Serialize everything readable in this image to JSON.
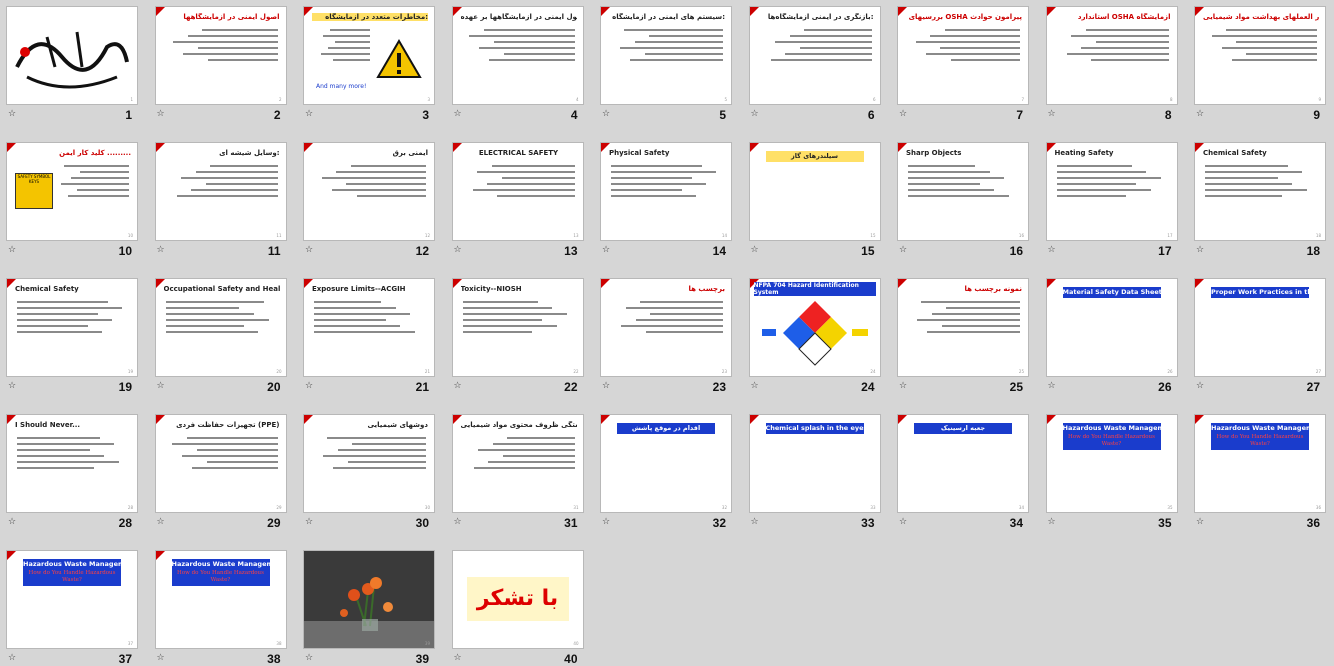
{
  "slides": [
    {
      "num": "1",
      "title": "",
      "kind": "calligraphy"
    },
    {
      "num": "2",
      "title": "اصول ایمنی در آزمایشگاهها",
      "kind": "red-title"
    },
    {
      "num": "3",
      "title": "مخاطرات متعدد در آزمایشگاه:",
      "kind": "warning",
      "extra": "And many more!"
    },
    {
      "num": "4",
      "title": "رعایت اصول ایمنی در آزمایشگاهها بر عهده",
      "kind": "bullets"
    },
    {
      "num": "5",
      "title": "سیستم های ایمنی در آزمایشگاه:",
      "kind": "bullets"
    },
    {
      "num": "6",
      "title": "بازنگری در ایمنی آزمایشگاه‌ها:",
      "kind": "bullets"
    },
    {
      "num": "7",
      "title": "بررسیهای OSHA پیرامون حوادث",
      "kind": "red-title"
    },
    {
      "num": "8",
      "title": "استاندارد OSHA آزمایشگاه",
      "kind": "red-title"
    },
    {
      "num": "9",
      "title": "دستور العملهای بهداشت مواد شیمیایی",
      "kind": "red-title"
    },
    {
      "num": "10",
      "title": "کلید کار ایمن .........",
      "kind": "red-title",
      "extra": "SAFETY SYMBOL KEYS"
    },
    {
      "num": "11",
      "title": "وسایل شیشه ای:",
      "kind": "bullets"
    },
    {
      "num": "12",
      "title": "ایمنی برق",
      "kind": "bullets"
    },
    {
      "num": "13",
      "title": "ELECTRICAL SAFETY",
      "kind": "center"
    },
    {
      "num": "14",
      "title": "Physical Safety",
      "kind": "ltr"
    },
    {
      "num": "15",
      "title": "سیلندرهای گاز",
      "kind": "yellow-banner"
    },
    {
      "num": "16",
      "title": "Sharp Objects",
      "kind": "ltr"
    },
    {
      "num": "17",
      "title": "Heating Safety",
      "kind": "ltr"
    },
    {
      "num": "18",
      "title": "Chemical Safety",
      "kind": "ltr"
    },
    {
      "num": "19",
      "title": "Chemical Safety",
      "kind": "ltr"
    },
    {
      "num": "20",
      "title": "Occupational Safety and Health Administration",
      "kind": "ltr"
    },
    {
      "num": "21",
      "title": "Exposure Limits--ACGIH",
      "kind": "ltr"
    },
    {
      "num": "22",
      "title": "Toxicity--NIOSH",
      "kind": "ltr"
    },
    {
      "num": "23",
      "title": "برچسب ها",
      "kind": "red-title"
    },
    {
      "num": "24",
      "title": "NFPA 704 Hazard Identification System",
      "kind": "diamond"
    },
    {
      "num": "25",
      "title": "نمونه برچسب ها",
      "kind": "red-title"
    },
    {
      "num": "26",
      "title": "Material Safety Data Sheets",
      "kind": "blue-banner"
    },
    {
      "num": "27",
      "title": "Proper Work Practices in the Laboratory",
      "kind": "blue-banner"
    },
    {
      "num": "28",
      "title": "I Should Never...",
      "kind": "ltr"
    },
    {
      "num": "29",
      "title": "تجهیزات حفاظت فردی (PPE)",
      "kind": "bullets"
    },
    {
      "num": "30",
      "title": "دوشهای شیمیایی",
      "kind": "bullets"
    },
    {
      "num": "31",
      "title": "راهنمای ایمنی در موارد ریختن و یا شکستگی ظروف محتوی مواد شیمیایی",
      "kind": "bullets"
    },
    {
      "num": "32",
      "title": "اقدام در موقع پاشش",
      "kind": "blue-banner"
    },
    {
      "num": "33",
      "title": "Chemical splash in the eyes!",
      "kind": "blue-banner"
    },
    {
      "num": "34",
      "title": "جعبه ارسینیک",
      "kind": "blue-banner"
    },
    {
      "num": "35",
      "title": "Hazardous Waste Management",
      "kind": "blue-banner",
      "extra": "How do You Handle Hazardous Waste?"
    },
    {
      "num": "36",
      "title": "Hazardous Waste Management",
      "kind": "blue-banner",
      "extra": "How do You Handle Hazardous Waste?"
    },
    {
      "num": "37",
      "title": "Hazardous Waste Management",
      "kind": "blue-banner",
      "extra": "How do You Handle Hazardous Waste?"
    },
    {
      "num": "38",
      "title": "Hazardous Waste Management",
      "kind": "blue-banner",
      "extra": "How do You Handle Hazardous Waste?"
    },
    {
      "num": "39",
      "title": "",
      "kind": "photo"
    },
    {
      "num": "40",
      "title": "با تشکر",
      "kind": "thanks"
    }
  ],
  "colors": {
    "background": "#d6d6d6",
    "accent_red": "#cc0000",
    "banner_blue": "#1a3ccc",
    "banner_yellow": "#ffe067"
  },
  "icons": {
    "slide_star": "star-icon",
    "corner": "corner-decoration-icon"
  }
}
